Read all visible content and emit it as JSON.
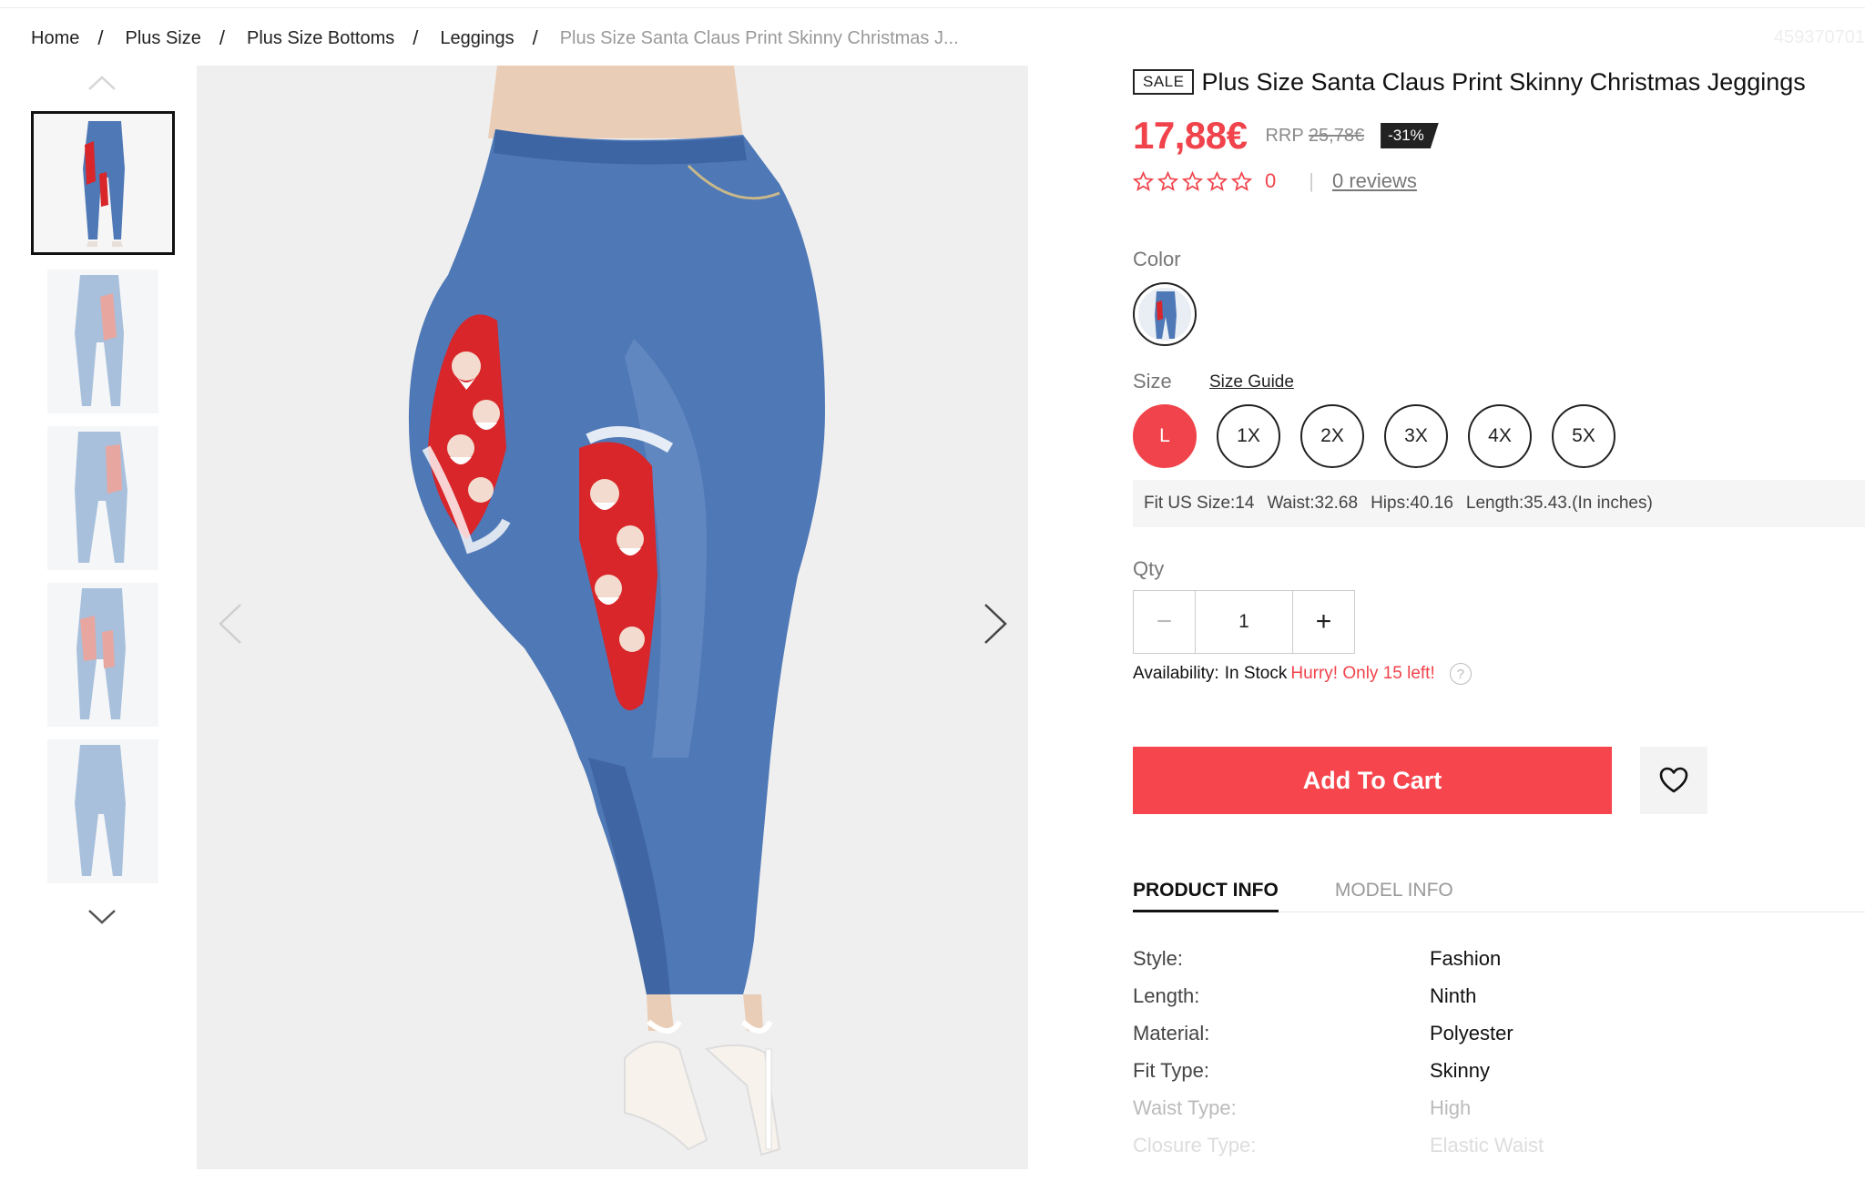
{
  "breadcrumb": {
    "items": [
      "Home",
      "Plus Size",
      "Plus Size Bottoms",
      "Leggings"
    ],
    "current": "Plus Size Santa Claus Print Skinny Christmas J...",
    "separator": "/"
  },
  "sku": "459370701",
  "product": {
    "badge": "SALE",
    "title": "Plus Size Santa Claus Print Skinny Christmas Jeggings",
    "price": "17,88€",
    "rrp_label": "RRP",
    "rrp_value": "25,78€",
    "discount": "-31%",
    "rating_value": 0,
    "rating_text": "0",
    "rating_separator": "|",
    "reviews": "0 reviews"
  },
  "color": {
    "label": "Color",
    "selected": "denim-santa-print"
  },
  "size": {
    "label": "Size",
    "guide": "Size Guide",
    "options": [
      "L",
      "1X",
      "2X",
      "3X",
      "4X",
      "5X"
    ],
    "selected": "L",
    "fit": {
      "us_size": "Fit US Size:14",
      "waist": "Waist:32.68",
      "hips": "Hips:40.16",
      "length": "Length:35.43.(In inches)"
    }
  },
  "qty": {
    "label": "Qty",
    "value": "1",
    "minus": "−",
    "plus": "+"
  },
  "availability": {
    "label": "Availability:",
    "stock": "In Stock",
    "hurry": "Hurry! Only 15 left!",
    "help": "?"
  },
  "actions": {
    "add_to_cart": "Add To Cart"
  },
  "tabs": [
    "PRODUCT INFO",
    "MODEL INFO"
  ],
  "specs": [
    {
      "key": "Style:",
      "value": "Fashion"
    },
    {
      "key": "Length:",
      "value": "Ninth"
    },
    {
      "key": "Material:",
      "value": "Polyester"
    },
    {
      "key": "Fit Type:",
      "value": "Skinny"
    },
    {
      "key": "Waist Type:",
      "value": "High"
    },
    {
      "key": "Closure Type:",
      "value": "Elastic Waist"
    }
  ],
  "colors": {
    "accent": "#f0434b",
    "denim": "#4f78b6",
    "santa_red": "#d8262a"
  }
}
